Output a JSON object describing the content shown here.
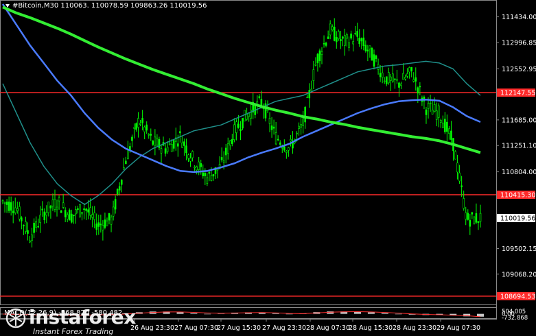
{
  "header": {
    "symbol_line": "#Bitcoin,M30",
    "ohlc": "110063.  110078.59 109863.26 110019.56"
  },
  "macd": {
    "label": "MACD(12,26,9) -568.870 -580.482",
    "scale_labels": [
      "504.005",
      "0.00",
      "-732.868"
    ]
  },
  "price_axis": {
    "labels": [
      "111434.00",
      "112996.85",
      "112552.95",
      "111685.00",
      "111251.10",
      "110804.00",
      "109502.15",
      "109068.20"
    ],
    "label_values": [
      113434,
      112996.85,
      112552.95,
      111685,
      111251.1,
      110804,
      109502.15,
      109068.2
    ],
    "current_price_label": "110019.56",
    "current_price": 110019.56
  },
  "time_axis": {
    "labels": [
      "26 Aug 23:30",
      "27 Aug 07:30",
      "27 Aug 15:30",
      "27 Aug 23:30",
      "28 Aug 07:30",
      "28 Aug 15:30",
      "28 Aug 23:30",
      "29 Aug 07:30"
    ]
  },
  "levels": [
    {
      "label": "112147.55",
      "value": 112147.55,
      "color": "#ff2a2a"
    },
    {
      "label": "110415.30",
      "value": 110415.3,
      "color": "#ff2a2a"
    },
    {
      "label": "108694.53",
      "value": 108694.53,
      "color": "#ff2a2a"
    }
  ],
  "logo": {
    "brand": "instaforex",
    "tagline": "Instant Forex Trading"
  },
  "colors": {
    "candles": "#00ff00",
    "ma_slow": "#33ee33",
    "ma_mid": "#4a7bff",
    "ma_fast": "#1f8f8a",
    "macd_hist": "#c8c8c8",
    "macd_signal": "#ff3030",
    "level": "#ff2a2a"
  },
  "chart_data": {
    "type": "line",
    "title": "",
    "xlabel": "",
    "ylabel": "",
    "ylim": [
      108600,
      113650
    ],
    "x": [
      0,
      1,
      2,
      3,
      4,
      5,
      6,
      7,
      8,
      9,
      10,
      11,
      12,
      13,
      14,
      15,
      16,
      17,
      18,
      19,
      20,
      21,
      22,
      23,
      24,
      25,
      26,
      27,
      28,
      29,
      30,
      31,
      32,
      33,
      34,
      35
    ],
    "series": [
      {
        "values": [
          110300,
          110200,
          109700,
          110100,
          110300,
          110050,
          110200,
          109900,
          110000,
          111000,
          111700,
          111300,
          111200,
          111400,
          111000,
          110700,
          110900,
          111500,
          111800,
          112000,
          111400,
          111200,
          111600,
          112700,
          113200,
          113000,
          113100,
          112800,
          112400,
          112300,
          112500,
          111900,
          111800,
          111300,
          110000,
          110020
        ]
      },
      {
        "values": [
          113650,
          113300,
          112950,
          112650,
          112350,
          112100,
          111800,
          111550,
          111350,
          111200,
          111100,
          111000,
          110900,
          110820,
          110800,
          110820,
          110880,
          110950,
          111050,
          111130,
          111200,
          111280,
          111400,
          111500,
          111600,
          111700,
          111800,
          111880,
          111950,
          112000,
          112020,
          112030,
          112010,
          111900,
          111750,
          111650
        ]
      },
      {
        "values": [
          112300,
          111800,
          111300,
          110900,
          110600,
          110400,
          110250,
          110400,
          110600,
          110850,
          111050,
          111200,
          111300,
          111400,
          111500,
          111550,
          111600,
          111700,
          111800,
          111900,
          112000,
          112050,
          112100,
          112200,
          112300,
          112400,
          112500,
          112550,
          112600,
          112620,
          112650,
          112680,
          112650,
          112550,
          112300,
          112100
        ]
      },
      {
        "values": [
          113600,
          113500,
          113420,
          113330,
          113240,
          113140,
          113030,
          112920,
          112820,
          112720,
          112630,
          112540,
          112460,
          112380,
          112300,
          112210,
          112130,
          112050,
          111980,
          111910,
          111850,
          111800,
          111740,
          111700,
          111650,
          111610,
          111560,
          111520,
          111480,
          111440,
          111400,
          111370,
          111330,
          111270,
          111200,
          111130
        ]
      }
    ],
    "macd": {
      "histogram": [
        -80,
        -120,
        -200,
        -260,
        -300,
        -260,
        -200,
        -120,
        -40,
        120,
        320,
        460,
        460,
        320,
        140,
        0,
        120,
        240,
        300,
        260,
        120,
        -40,
        60,
        340,
        480,
        470,
        420,
        300,
        160,
        -40,
        -160,
        -240,
        -220,
        -340,
        -500,
        -569
      ],
      "signal": [
        -40,
        -100,
        -180,
        -240,
        -280,
        -290,
        -260,
        -200,
        -140,
        -40,
        120,
        280,
        380,
        380,
        300,
        170,
        110,
        160,
        230,
        260,
        200,
        80,
        40,
        170,
        320,
        410,
        430,
        380,
        280,
        140,
        0,
        -120,
        -180,
        -260,
        -380,
        -580
      ],
      "ylim": [
        -733,
        504
      ]
    }
  }
}
